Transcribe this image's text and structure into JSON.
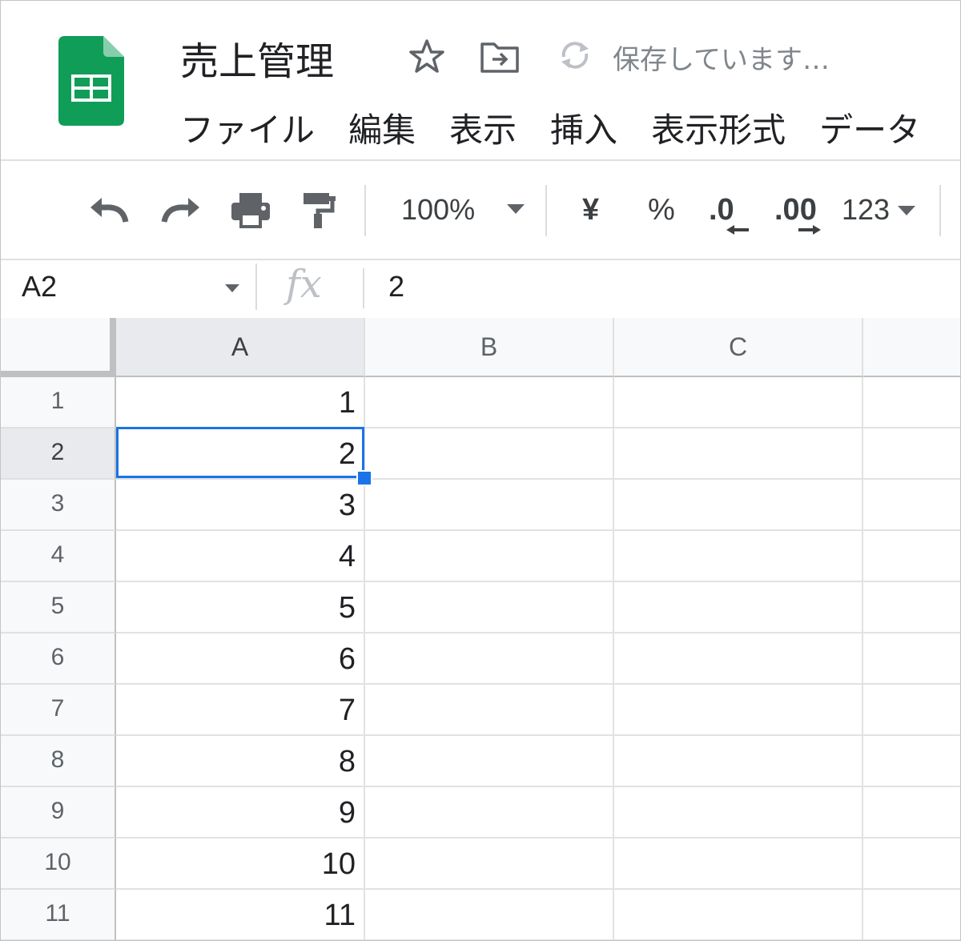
{
  "app": {
    "title": "売上管理",
    "save_status": "保存しています…",
    "brand_color": "#0f9d58"
  },
  "menu": {
    "items": [
      "ファイル",
      "編集",
      "表示",
      "挿入",
      "表示形式",
      "データ"
    ]
  },
  "toolbar": {
    "zoom": "100%",
    "currency": "¥",
    "percent": "%",
    "decrease_decimal": ".0",
    "increase_decimal": ".00",
    "more_formats": "123"
  },
  "formula_bar": {
    "name_box": "A2",
    "fx_label": "fx",
    "value": "2"
  },
  "sheet": {
    "columns": [
      "A",
      "B",
      "C"
    ],
    "rows": [
      "1",
      "2",
      "3",
      "4",
      "5",
      "6",
      "7",
      "8",
      "9",
      "10",
      "11"
    ],
    "column_a_values": [
      "1",
      "2",
      "3",
      "4",
      "5",
      "6",
      "7",
      "8",
      "9",
      "10",
      "11"
    ],
    "selected_cell": "A2",
    "selection_color": "#1a73e8"
  }
}
